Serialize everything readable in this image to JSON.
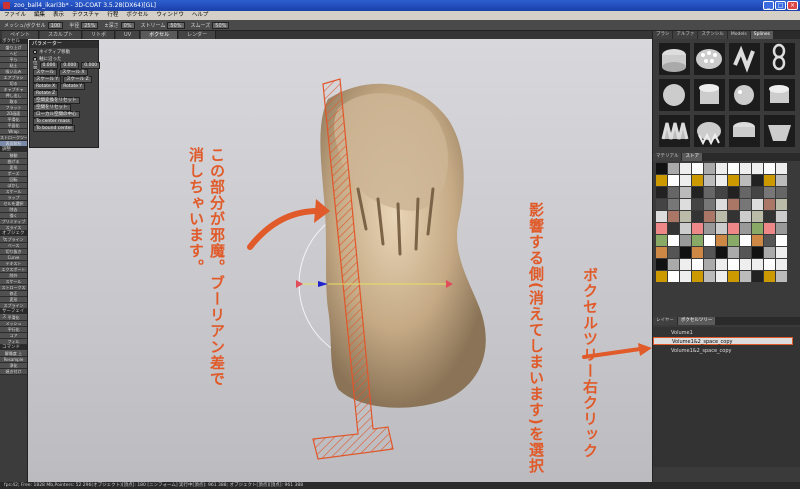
{
  "window": {
    "title": "zoo_ball4_ikari3b* - 3D-COAT 3.5.28(DX64)[GL]"
  },
  "menu": [
    "ファイル",
    "編集",
    "表示",
    "テクスチャ",
    "行程",
    "ボクセル",
    "ウィンドウ",
    "ヘルプ"
  ],
  "toolbar": {
    "items": [
      {
        "label": "メッシュ/ボクセル",
        "value": "100"
      },
      {
        "label": "半径",
        "value": "25%"
      },
      {
        "label": "±深さ",
        "value": "0%"
      },
      {
        "label": "ストリーム",
        "value": "50%"
      },
      {
        "label": "スムーズ",
        "value": "50%"
      }
    ]
  },
  "tabs": [
    "ペイント",
    "スカルプト",
    "リトポ",
    "UV",
    "ボクセル",
    "レンダー"
  ],
  "active_tab": "ボクセル",
  "left_tools": {
    "voxel_header": "ボクセル",
    "voxel_items": [
      "盛り上げ",
      "ヘビ",
      "平ら",
      "粘土",
      "吸い込み",
      "エアブラシ",
      "切る",
      "キャプチャ",
      "押し出し",
      "取る",
      "フラット",
      "2D画面",
      "平滑化",
      "平面化",
      "Wrap",
      "ストロークツール",
      "表面解析"
    ],
    "adjust_header": "調整",
    "adjust_items": [
      "移動",
      "曲げる",
      "変形",
      "ポーズ",
      "回転",
      "ぼかし",
      "スケール",
      "ラップ",
      "セルを選択",
      "除去",
      "描く",
      "プリミティブ",
      "スライス"
    ],
    "objects_header": "オブジェクト",
    "objects_items": [
      "スプライン",
      "ベース",
      "切り抜き",
      "Curve",
      "テキスト",
      "エクスポート",
      "除外",
      "スケール",
      "ストロークス",
      "修正",
      "変形",
      "スプライン"
    ],
    "surface_header": "サーフェイス",
    "surface_items": [
      "平滑化",
      "メッシュ",
      "平行化",
      "コア",
      "フィル"
    ],
    "command_header": "コマンド",
    "command_items": [
      "解像度 上",
      "Resample",
      "浄化",
      "焼き付け"
    ]
  },
  "params": {
    "title": "パラメーター",
    "options": [
      "ネイティブ移動",
      "軸に沿った"
    ],
    "position_label": "位置",
    "position_values": [
      "0.000",
      "0.000",
      "0.000"
    ],
    "scale_label": "スケール",
    "scale_x": "スケール X",
    "scale_y": "スケール Y",
    "scale_z": "スケール Z",
    "rotate_x": "Rotate X",
    "rotate_y": "Rotate Y",
    "rotate_z": "Rotate Z",
    "btn1": "空間変換をリセット",
    "btn2": "空間をリセット",
    "btn3": "ローカル空間の中心",
    "btn4": "To center mass",
    "btn5": "To bound center"
  },
  "right_panel": {
    "top_tabs": [
      "ブラシ",
      "アルファ",
      "ステンシル",
      "Models",
      "Splines"
    ],
    "mat_tabs": [
      "マテリアル",
      "ストア"
    ],
    "layer_tabs": [
      "レイヤー",
      "ボクセルツリー"
    ],
    "tree_items": [
      "Volume1",
      "Volume1&2_space_copy",
      "Volume1&2_space_copy"
    ]
  },
  "annotations": {
    "left_note": "この部分が邪魔。ブーリアン差で消しちゃいます。",
    "middle_note": "影響する側(消えてしまいます)を選択",
    "right_note": "ボクセルツリー右クリック"
  },
  "status": "fps:42;    Free: 1828 Mb,Pointers: 52 296(オブジェクト)[頂点]: 180 [ニンフォーム] 実行中[頂点]: 961 388; オブジェクト[頂点][頂点]: 961 388"
}
